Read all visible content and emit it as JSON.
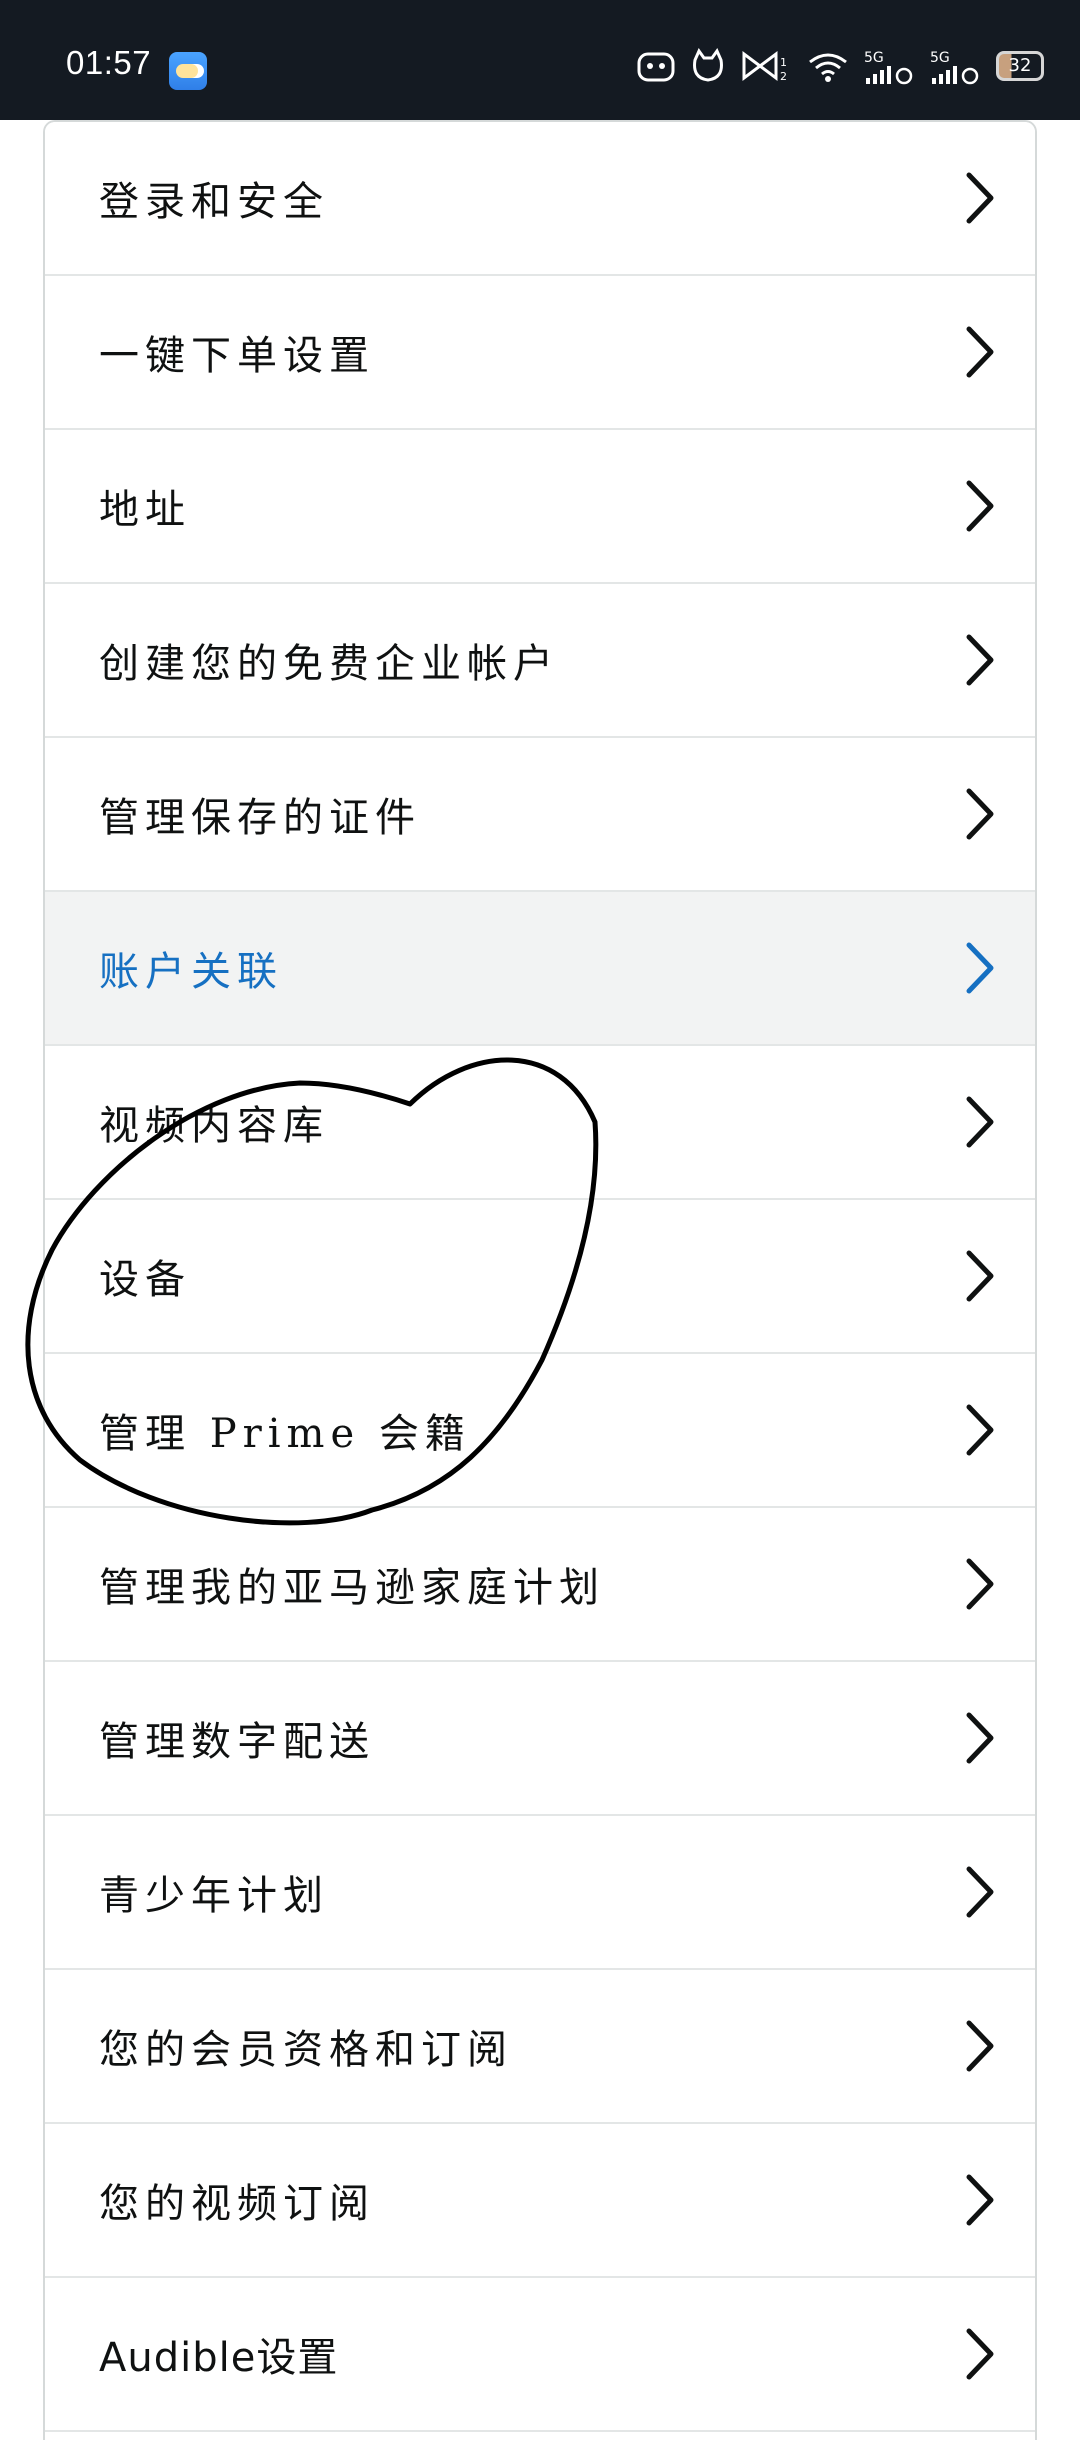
{
  "status_bar": {
    "time": "01:57",
    "battery": "32",
    "signal_labels": [
      "5G",
      "5G"
    ]
  },
  "menu": {
    "items": [
      {
        "label": "登录和安全",
        "highlighted": false
      },
      {
        "label": "一键下单设置",
        "highlighted": false
      },
      {
        "label": "地址",
        "highlighted": false
      },
      {
        "label": "创建您的免费企业帐户",
        "highlighted": false
      },
      {
        "label": "管理保存的证件",
        "highlighted": false
      },
      {
        "label": "账户关联",
        "highlighted": true
      },
      {
        "label": "视频内容库",
        "highlighted": false
      },
      {
        "label": "设备",
        "highlighted": false
      },
      {
        "label": "管理 Prime 会籍",
        "highlighted": false
      },
      {
        "label": "管理我的亚马逊家庭计划",
        "highlighted": false
      },
      {
        "label": "管理数字配送",
        "highlighted": false
      },
      {
        "label": "青少年计划",
        "highlighted": false
      },
      {
        "label": "您的会员资格和订阅",
        "highlighted": false
      },
      {
        "label": "您的视频订阅",
        "highlighted": false
      },
      {
        "label": "Audible设置",
        "highlighted": false
      }
    ]
  },
  "colors": {
    "status_bar_bg": "#141a22",
    "text": "#0f1111",
    "link_accent": "#1670c2",
    "highlight_bg": "#f2f3f3",
    "divider": "#e3e6e6"
  },
  "icons": {
    "row_chevron": "chevron-right-icon",
    "annotation": "hand-drawn-circle"
  }
}
